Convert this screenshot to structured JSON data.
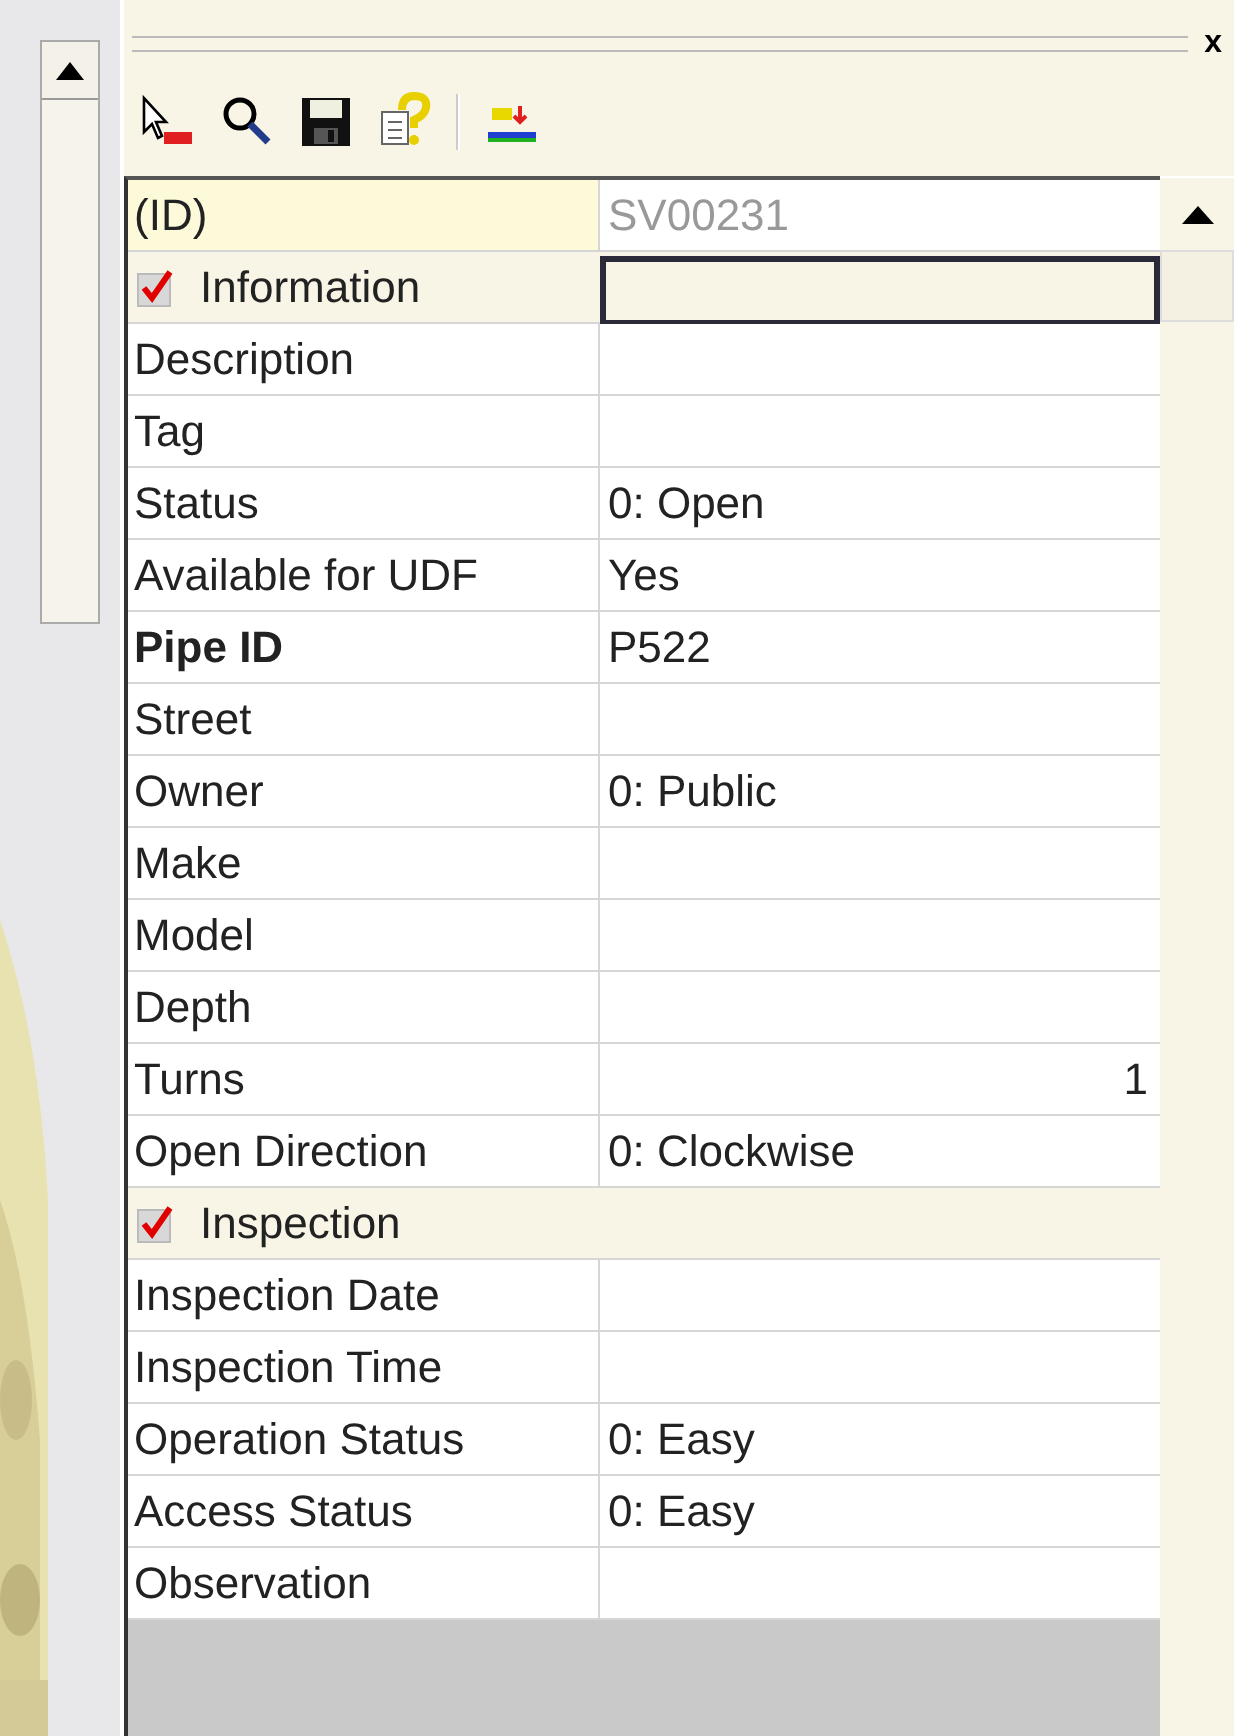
{
  "panel": {
    "close": "x"
  },
  "toolbar": [
    {
      "kind": "select-udf"
    },
    {
      "kind": "search"
    },
    {
      "kind": "save"
    },
    {
      "kind": "help"
    },
    {
      "kind": "id-sort"
    }
  ],
  "grid": {
    "rows": [
      {
        "kind": "key",
        "label": "(ID)",
        "value": "SV00231",
        "disabled": true
      },
      {
        "kind": "category",
        "label": "Information",
        "checked": true,
        "selected": true
      },
      {
        "kind": "property",
        "label": "Description",
        "bold": false
      },
      {
        "kind": "property",
        "label": "Tag",
        "bold": false
      },
      {
        "kind": "property",
        "label": "Status",
        "value": "0: Open",
        "bold": false
      },
      {
        "kind": "property",
        "label": "Available for UDF",
        "value": "Yes",
        "bold": false
      },
      {
        "kind": "property",
        "label": "Pipe ID",
        "value": "P522",
        "bold": true
      },
      {
        "kind": "property",
        "label": "Street",
        "bold": false
      },
      {
        "kind": "property",
        "label": "Owner",
        "value": "0: Public",
        "bold": false
      },
      {
        "kind": "property",
        "label": "Make",
        "bold": false
      },
      {
        "kind": "property",
        "label": "Model",
        "bold": false
      },
      {
        "kind": "property",
        "label": "Depth",
        "bold": false
      },
      {
        "kind": "property",
        "label": "Turns",
        "value": "1",
        "bold": false,
        "right_aligned": true
      },
      {
        "kind": "property",
        "label": "Open Direction",
        "value": "0: Clockwise",
        "bold": false
      },
      {
        "kind": "category",
        "label": "Inspection",
        "checked": true,
        "selected": false
      },
      {
        "kind": "property",
        "label": "Inspection Date",
        "bold": false
      },
      {
        "kind": "property",
        "label": "Inspection Time",
        "bold": false
      },
      {
        "kind": "property",
        "label": "Operation Status",
        "value": "0: Easy",
        "bold": false
      },
      {
        "kind": "property",
        "label": "Access Status",
        "value": "0: Easy",
        "bold": false
      },
      {
        "kind": "property",
        "label": "Observation",
        "bold": false
      }
    ]
  }
}
